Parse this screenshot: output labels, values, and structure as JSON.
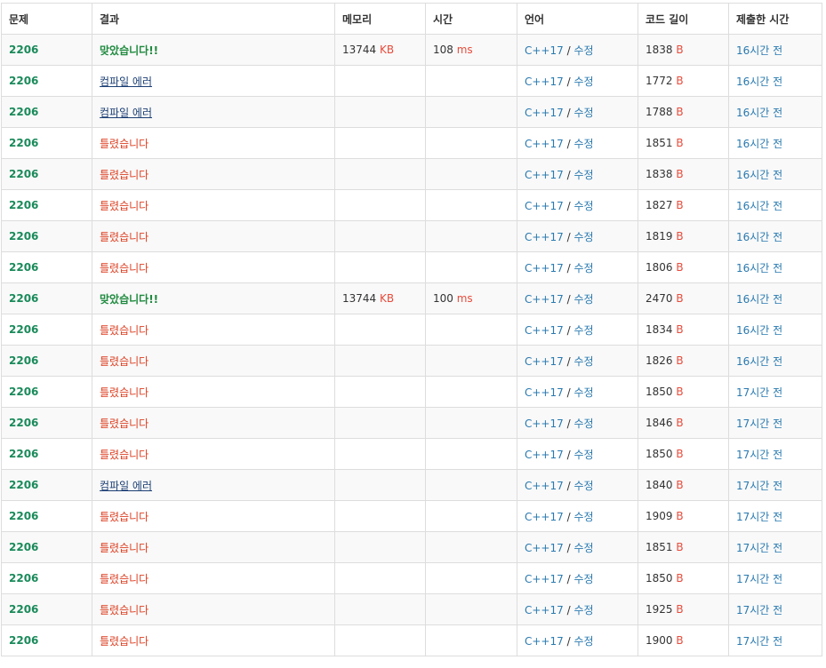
{
  "headers": [
    "문제",
    "결과",
    "메모리",
    "시간",
    "언어",
    "코드 길이",
    "제출한 시간"
  ],
  "units": {
    "memory": "KB",
    "time": "ms",
    "length": "B"
  },
  "lang_sep": "/",
  "rows": [
    {
      "problem": "2206",
      "result": "맞았습니다!!",
      "result_type": "ac",
      "memory": "13744",
      "time": "108",
      "lang": "C++17",
      "edit": "수정",
      "length": "1838",
      "submitted": "16시간 전"
    },
    {
      "problem": "2206",
      "result": "컴파일 에러",
      "result_type": "ce",
      "memory": "",
      "time": "",
      "lang": "C++17",
      "edit": "수정",
      "length": "1772",
      "submitted": "16시간 전"
    },
    {
      "problem": "2206",
      "result": "컴파일 에러",
      "result_type": "ce",
      "memory": "",
      "time": "",
      "lang": "C++17",
      "edit": "수정",
      "length": "1788",
      "submitted": "16시간 전"
    },
    {
      "problem": "2206",
      "result": "틀렸습니다",
      "result_type": "wa",
      "memory": "",
      "time": "",
      "lang": "C++17",
      "edit": "수정",
      "length": "1851",
      "submitted": "16시간 전"
    },
    {
      "problem": "2206",
      "result": "틀렸습니다",
      "result_type": "wa",
      "memory": "",
      "time": "",
      "lang": "C++17",
      "edit": "수정",
      "length": "1838",
      "submitted": "16시간 전"
    },
    {
      "problem": "2206",
      "result": "틀렸습니다",
      "result_type": "wa",
      "memory": "",
      "time": "",
      "lang": "C++17",
      "edit": "수정",
      "length": "1827",
      "submitted": "16시간 전"
    },
    {
      "problem": "2206",
      "result": "틀렸습니다",
      "result_type": "wa",
      "memory": "",
      "time": "",
      "lang": "C++17",
      "edit": "수정",
      "length": "1819",
      "submitted": "16시간 전"
    },
    {
      "problem": "2206",
      "result": "틀렸습니다",
      "result_type": "wa",
      "memory": "",
      "time": "",
      "lang": "C++17",
      "edit": "수정",
      "length": "1806",
      "submitted": "16시간 전"
    },
    {
      "problem": "2206",
      "result": "맞았습니다!!",
      "result_type": "ac",
      "memory": "13744",
      "time": "100",
      "lang": "C++17",
      "edit": "수정",
      "length": "2470",
      "submitted": "16시간 전"
    },
    {
      "problem": "2206",
      "result": "틀렸습니다",
      "result_type": "wa",
      "memory": "",
      "time": "",
      "lang": "C++17",
      "edit": "수정",
      "length": "1834",
      "submitted": "16시간 전"
    },
    {
      "problem": "2206",
      "result": "틀렸습니다",
      "result_type": "wa",
      "memory": "",
      "time": "",
      "lang": "C++17",
      "edit": "수정",
      "length": "1826",
      "submitted": "16시간 전"
    },
    {
      "problem": "2206",
      "result": "틀렸습니다",
      "result_type": "wa",
      "memory": "",
      "time": "",
      "lang": "C++17",
      "edit": "수정",
      "length": "1850",
      "submitted": "17시간 전"
    },
    {
      "problem": "2206",
      "result": "틀렸습니다",
      "result_type": "wa",
      "memory": "",
      "time": "",
      "lang": "C++17",
      "edit": "수정",
      "length": "1846",
      "submitted": "17시간 전"
    },
    {
      "problem": "2206",
      "result": "틀렸습니다",
      "result_type": "wa",
      "memory": "",
      "time": "",
      "lang": "C++17",
      "edit": "수정",
      "length": "1850",
      "submitted": "17시간 전"
    },
    {
      "problem": "2206",
      "result": "컴파일 에러",
      "result_type": "ce",
      "memory": "",
      "time": "",
      "lang": "C++17",
      "edit": "수정",
      "length": "1840",
      "submitted": "17시간 전"
    },
    {
      "problem": "2206",
      "result": "틀렸습니다",
      "result_type": "wa",
      "memory": "",
      "time": "",
      "lang": "C++17",
      "edit": "수정",
      "length": "1909",
      "submitted": "17시간 전"
    },
    {
      "problem": "2206",
      "result": "틀렸습니다",
      "result_type": "wa",
      "memory": "",
      "time": "",
      "lang": "C++17",
      "edit": "수정",
      "length": "1851",
      "submitted": "17시간 전"
    },
    {
      "problem": "2206",
      "result": "틀렸습니다",
      "result_type": "wa",
      "memory": "",
      "time": "",
      "lang": "C++17",
      "edit": "수정",
      "length": "1850",
      "submitted": "17시간 전"
    },
    {
      "problem": "2206",
      "result": "틀렸습니다",
      "result_type": "wa",
      "memory": "",
      "time": "",
      "lang": "C++17",
      "edit": "수정",
      "length": "1925",
      "submitted": "17시간 전"
    },
    {
      "problem": "2206",
      "result": "틀렸습니다",
      "result_type": "wa",
      "memory": "",
      "time": "",
      "lang": "C++17",
      "edit": "수정",
      "length": "1900",
      "submitted": "17시간 전"
    }
  ],
  "colors": {
    "accepted": "#1f8a3f",
    "wrong": "#dd4124",
    "compile_error": "#1c3f74",
    "link": "#2a7ab0",
    "unit": "#e74c3c",
    "problem": "#1a8a5a"
  }
}
